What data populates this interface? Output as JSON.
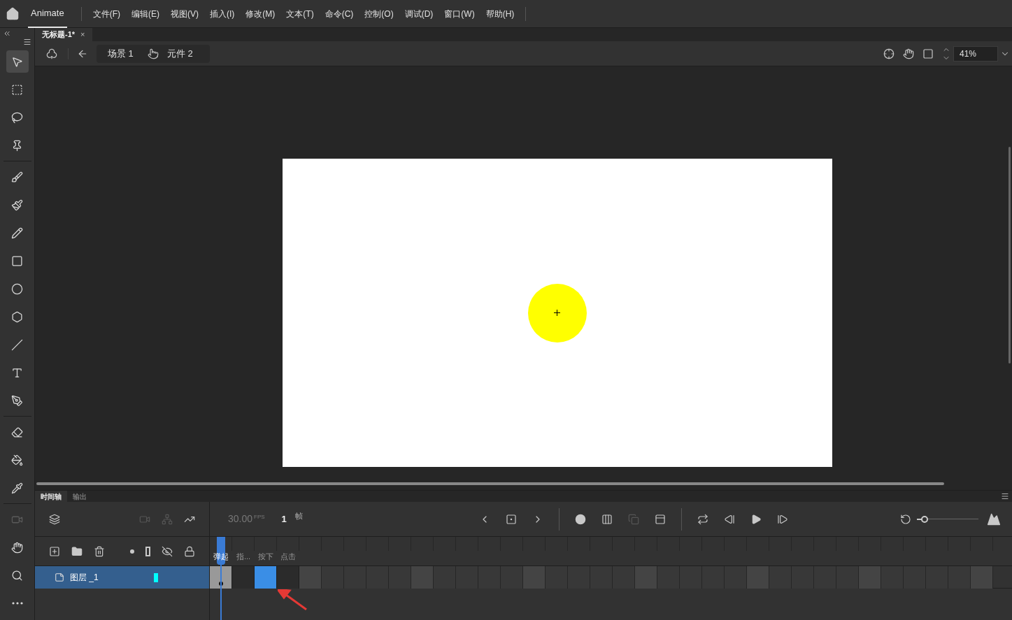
{
  "menu_bar": {
    "app_name": "Animate",
    "items": [
      "文件(F)",
      "编辑(E)",
      "视图(V)",
      "插入(I)",
      "修改(M)",
      "文本(T)",
      "命令(C)",
      "控制(O)",
      "调试(D)",
      "窗口(W)",
      "帮助(H)"
    ]
  },
  "document_tabs": [
    {
      "title": "无标题-1*",
      "close": "×",
      "selected": true
    }
  ],
  "edit_bar": {
    "breadcrumbs": [
      {
        "kind": "scene",
        "label": "场景 1"
      },
      {
        "kind": "symbol",
        "label": "元件 2"
      }
    ],
    "zoom": "41%"
  },
  "tool_groups": [
    [
      {
        "kind": "select",
        "selected": true,
        "disabled": false
      },
      {
        "kind": "transform",
        "selected": false,
        "disabled": false
      },
      {
        "kind": "lasso",
        "selected": false,
        "disabled": false
      },
      {
        "kind": "pin",
        "selected": false,
        "disabled": false
      }
    ],
    [
      {
        "kind": "fluid-brush",
        "selected": false,
        "disabled": false
      },
      {
        "kind": "brush",
        "selected": false,
        "disabled": false
      },
      {
        "kind": "pencil",
        "selected": false,
        "disabled": false
      },
      {
        "kind": "rectangle",
        "selected": false,
        "disabled": false
      },
      {
        "kind": "oval",
        "selected": false,
        "disabled": false
      },
      {
        "kind": "polygon",
        "selected": false,
        "disabled": false
      },
      {
        "kind": "line",
        "selected": false,
        "disabled": false
      },
      {
        "kind": "text",
        "selected": false,
        "disabled": false
      },
      {
        "kind": "pen",
        "selected": false,
        "disabled": false
      }
    ],
    [
      {
        "kind": "eraser",
        "selected": false,
        "disabled": false
      },
      {
        "kind": "bucket",
        "selected": false,
        "disabled": false
      },
      {
        "kind": "eyedropper",
        "selected": false,
        "disabled": false
      }
    ],
    [
      {
        "kind": "camera",
        "selected": false,
        "disabled": true
      },
      {
        "kind": "hand",
        "selected": false,
        "disabled": false
      },
      {
        "kind": "zoom",
        "selected": false,
        "disabled": false
      },
      {
        "kind": "more",
        "selected": false,
        "disabled": false
      }
    ]
  ],
  "timeline": {
    "tabs": [
      {
        "label": "时间轴",
        "selected": true
      },
      {
        "label": "输出",
        "selected": false
      }
    ],
    "zoom_slider": {
      "level": 0.12
    },
    "fps": "30.00",
    "fps_unit": "FPS",
    "frame": "1",
    "frame_unit": "帧",
    "frame_labels": [
      "弹起",
      "指...",
      "按下",
      "点击"
    ],
    "layers": [
      {
        "name": "图层 _1",
        "selected": true,
        "color": "#00ffff"
      }
    ],
    "frames": [
      {
        "kind": "keyframe",
        "selected": false
      },
      {
        "kind": "blank",
        "selected": false
      },
      {
        "kind": "blank",
        "selected": true
      },
      {
        "kind": "blank",
        "selected": false
      }
    ]
  }
}
